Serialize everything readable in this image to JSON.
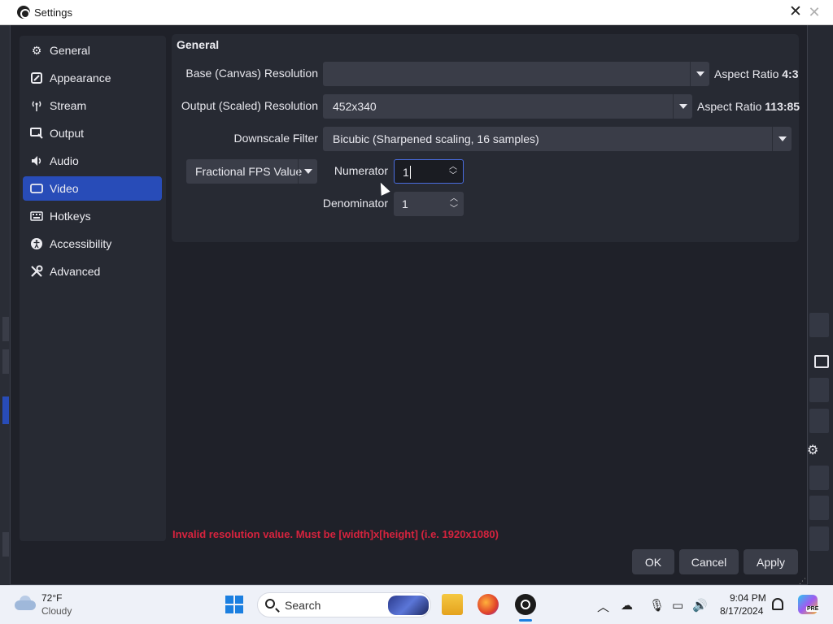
{
  "window": {
    "title": "Settings",
    "close_glyph": "✕",
    "bg_close_glyph": "✕"
  },
  "sidebar": {
    "items": [
      {
        "label": "General",
        "icon": "gear-icon"
      },
      {
        "label": "Appearance",
        "icon": "appearance-icon"
      },
      {
        "label": "Stream",
        "icon": "broadcast-icon"
      },
      {
        "label": "Output",
        "icon": "output-icon"
      },
      {
        "label": "Audio",
        "icon": "speaker-icon"
      },
      {
        "label": "Video",
        "icon": "monitor-icon",
        "active": true
      },
      {
        "label": "Hotkeys",
        "icon": "keyboard-icon"
      },
      {
        "label": "Accessibility",
        "icon": "accessibility-icon"
      },
      {
        "label": "Advanced",
        "icon": "tools-icon"
      }
    ]
  },
  "video": {
    "section_title": "General",
    "base_label": "Base (Canvas) Resolution",
    "base_value": "",
    "base_aspect_prefix": "Aspect Ratio",
    "base_aspect_value": "4:3",
    "output_label": "Output (Scaled) Resolution",
    "output_value": "452x340",
    "output_aspect_prefix": "Aspect Ratio",
    "output_aspect_value": "113:85",
    "downscale_label": "Downscale Filter",
    "downscale_value": "Bicubic (Sharpened scaling, 16 samples)",
    "fps_mode": "Fractional FPS Value",
    "numerator_label": "Numerator",
    "numerator_value": "1",
    "denominator_label": "Denominator",
    "denominator_value": "1"
  },
  "error_text": "Invalid resolution value. Must be [width]x[height] (i.e. 1920x1080)",
  "buttons": {
    "ok": "OK",
    "cancel": "Cancel",
    "apply": "Apply"
  },
  "taskbar": {
    "weather_temp": "72°F",
    "weather_cond": "Cloudy",
    "search_placeholder": "Search",
    "time": "9:04 PM",
    "date": "8/17/2024",
    "copilot_badge": "PRE"
  },
  "colors": {
    "accent": "#284cb8",
    "error": "#d6233e",
    "background": "#1f2129",
    "panel": "#272a33"
  }
}
